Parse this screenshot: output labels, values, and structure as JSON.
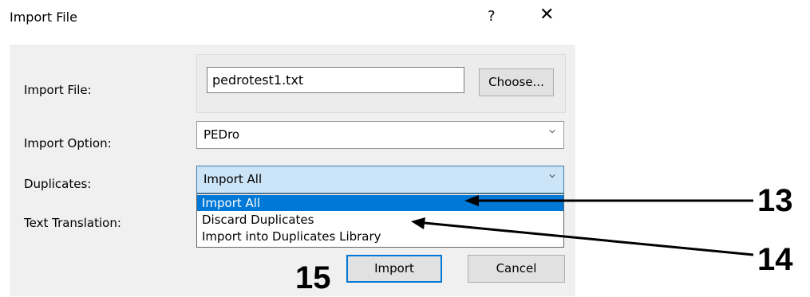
{
  "dialog": {
    "title": "Import File",
    "help_label": "?",
    "close_label": "✕"
  },
  "form": {
    "import_file_label": "Import File:",
    "import_file_value": "pedrotest1.txt",
    "choose_label": "Choose...",
    "import_option_label": "Import Option:",
    "import_option_value": "PEDro",
    "duplicates_label": "Duplicates:",
    "duplicates_value": "Import All",
    "text_translation_label": "Text Translation:"
  },
  "duplicates_options": [
    "Import All",
    "Discard Duplicates",
    "Import into Duplicates Library"
  ],
  "buttons": {
    "import_label": "Import",
    "cancel_label": "Cancel"
  },
  "callouts": {
    "c13": "13",
    "c14": "14",
    "c15": "15"
  },
  "colors": {
    "selection": "#0078d7",
    "focused_combo": "#cce4f7",
    "dialog_bg": "#f0f0f0"
  },
  "icons": {
    "dropdown": "chevron-down-icon"
  }
}
